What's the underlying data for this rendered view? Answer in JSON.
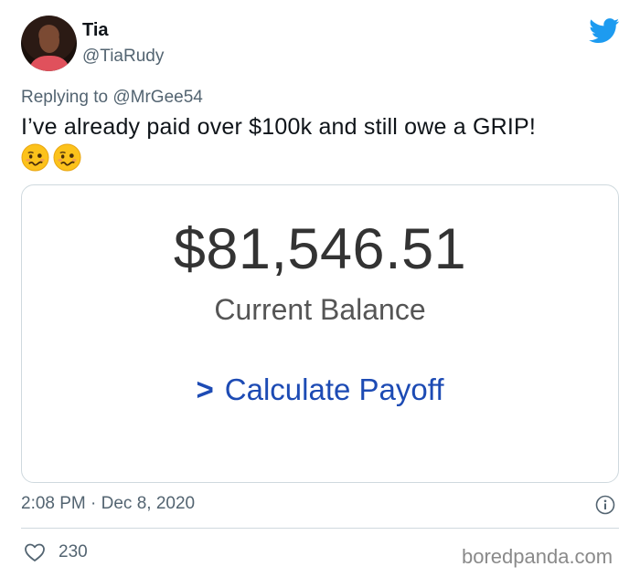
{
  "user": {
    "display_name": "Tia",
    "handle": "@TiaRudy"
  },
  "reply": {
    "prefix": "Replying to",
    "mention": "@MrGee54"
  },
  "tweet": {
    "text": "I’ve already paid over $100k and still owe a GRIP!",
    "emojis": [
      "woozy-face",
      "woozy-face"
    ],
    "timestamp": "2:08 PM · Dec 8, 2020",
    "likes": "230"
  },
  "card": {
    "amount": "$81,546.51",
    "label": "Current Balance",
    "link_chevron": ">",
    "link_text": "Calculate Payoff"
  },
  "watermark": "boredpanda.com",
  "colors": {
    "twitter_blue": "#1d9bf0",
    "link_blue": "#1d4bb4",
    "secondary_text": "#536471",
    "border": "#cfd9de"
  }
}
